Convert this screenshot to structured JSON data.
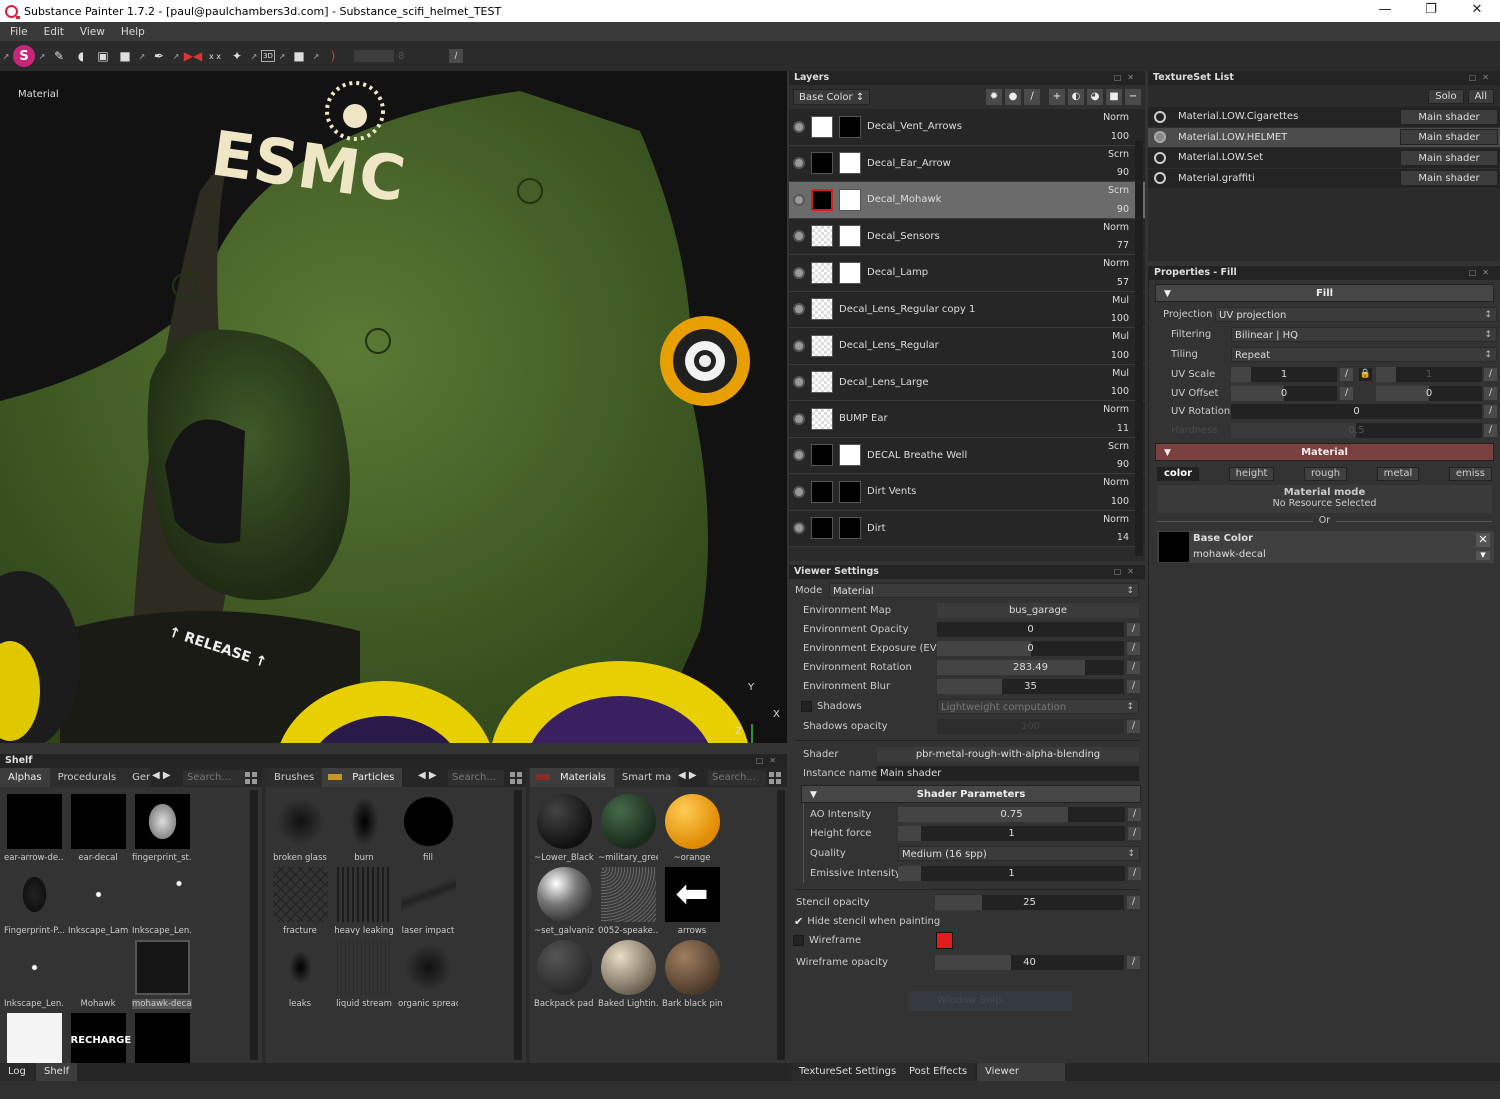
{
  "window": {
    "title": "Substance Painter 1.7.2 - [paul@paulchambers3d.com] - Substance_scifi_helmet_TEST",
    "minimize": "—",
    "restore": "❐",
    "close": "✕"
  },
  "menu": [
    "File",
    "Edit",
    "View",
    "Help"
  ],
  "toolbar": {
    "brush_size_value": "8",
    "tools": [
      "paint-tool",
      "eraser-tool",
      "projection-tool",
      "polygon-fill-tool",
      "color-picker-tool",
      "symmetry-tool",
      "xx-tool",
      "smudge-tool",
      "3d-view-tool",
      "camera-tool",
      "lazy-mouse-tool"
    ]
  },
  "viewport": {
    "mode_label": "Material",
    "decal_text": "ESMC",
    "release_text": "↑ RELEASE ↑",
    "axis": {
      "x": "X",
      "y": "Y",
      "z": "Z"
    }
  },
  "layers": {
    "title": "Layers",
    "channel": "Base Color",
    "items": [
      {
        "name": "Decal_Vent_Arrows",
        "blend": "Norm",
        "opacity": "100",
        "thumb": "white",
        "mask": "black",
        "selected": false
      },
      {
        "name": "Decal_Ear_Arrow",
        "blend": "Scrn",
        "opacity": "90",
        "thumb": "black",
        "mask": "white",
        "selected": false
      },
      {
        "name": "Decal_Mohawk",
        "blend": "Scrn",
        "opacity": "90",
        "thumb": "black",
        "mask": "white",
        "selected": true
      },
      {
        "name": "Decal_Sensors",
        "blend": "Norm",
        "opacity": "77",
        "thumb": "checker",
        "mask": "white",
        "selected": false
      },
      {
        "name": "Decal_Lamp",
        "blend": "Norm",
        "opacity": "57",
        "thumb": "checker",
        "mask": "white",
        "selected": false
      },
      {
        "name": "Decal_Lens_Regular copy 1",
        "blend": "Mul",
        "opacity": "100",
        "thumb": "checker",
        "mask": null,
        "selected": false
      },
      {
        "name": "Decal_Lens_Regular",
        "blend": "Mul",
        "opacity": "100",
        "thumb": "checker",
        "mask": null,
        "selected": false
      },
      {
        "name": "Decal_Lens_Large",
        "blend": "Mul",
        "opacity": "100",
        "thumb": "checker",
        "mask": null,
        "selected": false
      },
      {
        "name": "BUMP Ear",
        "blend": "Norm",
        "opacity": "11",
        "thumb": "checker",
        "mask": null,
        "selected": false
      },
      {
        "name": "DECAL Breathe Well",
        "blend": "Scrn",
        "opacity": "90",
        "thumb": "black",
        "mask": "white",
        "selected": false
      },
      {
        "name": "Dirt Vents",
        "blend": "Norm",
        "opacity": "100",
        "thumb": "black",
        "mask": "black",
        "selected": false
      },
      {
        "name": "Dirt",
        "blend": "Norm",
        "opacity": "14",
        "thumb": "black",
        "mask": "black",
        "selected": false
      }
    ]
  },
  "textureset": {
    "title": "TextureSet List",
    "solo": "Solo",
    "all": "All",
    "items": [
      {
        "name": "Material.LOW.Cigarettes",
        "shader": "Main shader",
        "selected": false
      },
      {
        "name": "Material.LOW.HELMET",
        "shader": "Main shader",
        "selected": true
      },
      {
        "name": "Material.LOW.Set",
        "shader": "Main shader",
        "selected": false
      },
      {
        "name": "Material.graffiti",
        "shader": "Main shader",
        "selected": false
      }
    ]
  },
  "properties": {
    "title": "Properties - Fill",
    "fill_section": "Fill",
    "projection_label": "Projection",
    "projection_value": "UV projection",
    "filtering_label": "Filtering",
    "filtering_value": "Bilinear | HQ",
    "tiling_label": "Tiling",
    "tiling_value": "Repeat",
    "uv_scale_label": "UV Scale",
    "uv_scale_u": "1",
    "uv_scale_v": "1",
    "uv_offset_label": "UV Offset",
    "uv_offset_u": "0",
    "uv_offset_v": "0",
    "uv_rotation_label": "UV Rotation",
    "uv_rotation_value": "0",
    "hardness_label": "Hardness",
    "hardness_value": "0.5",
    "material_section": "Material",
    "channels": [
      "color",
      "height",
      "rough",
      "metal",
      "emiss"
    ],
    "active_channel": "color",
    "material_mode_title": "Material mode",
    "material_mode_status": "No Resource Selected",
    "or_label": "Or",
    "base_color_label": "Base Color",
    "base_color_resource": "mohawk-decal"
  },
  "viewer": {
    "title": "Viewer Settings",
    "mode_label": "Mode",
    "mode_value": "Material",
    "rows": [
      {
        "label": "Environment Map",
        "value": "bus_garage",
        "type": "button"
      },
      {
        "label": "Environment Opacity",
        "value": "0",
        "type": "slider",
        "fraction": 0.0
      },
      {
        "label": "Environment Exposure (EV)",
        "value": "0",
        "type": "slider",
        "fraction": 0.5
      },
      {
        "label": "Environment Rotation",
        "value": "283.49",
        "type": "slider",
        "fraction": 0.79
      },
      {
        "label": "Environment Blur",
        "value": "35",
        "type": "slider",
        "fraction": 0.35
      }
    ],
    "shadows_label": "Shadows",
    "shadows_value": "Lightweight computation",
    "shadows_checked": false,
    "shadows_opacity_label": "Shadows opacity",
    "shadows_opacity_value": "100",
    "shader_label": "Shader",
    "shader_value": "pbr-metal-rough-with-alpha-blending",
    "instance_label": "Instance name",
    "instance_value": "Main shader",
    "shader_params_title": "Shader Parameters",
    "ao_label": "AO Intensity",
    "ao_value": "0.75",
    "ao_fraction": 0.75,
    "height_force_label": "Height force",
    "height_force_value": "1",
    "height_force_fraction": 0.1,
    "quality_label": "Quality",
    "quality_value": "Medium (16 spp)",
    "emissive_label": "Emissive Intensity",
    "emissive_value": "1",
    "emissive_fraction": 0.1,
    "stencil_opacity_label": "Stencil opacity",
    "stencil_opacity_value": "25",
    "stencil_fraction": 0.25,
    "hide_stencil_label": "Hide stencil when painting",
    "hide_stencil_checked": true,
    "wireframe_label": "Wireframe",
    "wireframe_checked": false,
    "wireframe_color": "#e01c1c",
    "wireframe_opacity_label": "Wireframe opacity",
    "wireframe_opacity_value": "40",
    "wireframe_fraction": 0.4,
    "window_snip": "Window Snip"
  },
  "bottom_tabs_right": [
    "TextureSet Settings",
    "Post Effects",
    "Viewer Settings"
  ],
  "bottom_tabs_right_active": "Viewer Settings",
  "bottom_tabs_left": [
    "Log",
    "Shelf"
  ],
  "bottom_tabs_left_active": "Shelf",
  "shelf": {
    "title": "Shelf",
    "search_placeholder": "Search...",
    "pane1": {
      "tabs": [
        "Alphas",
        "Procedurals",
        "Ger"
      ],
      "active": "Alphas",
      "items": [
        "ear-arrow-de...",
        "ear-decal",
        "fingerprint_st...",
        "Fingerprint-P...",
        "Inkscape_Lamp",
        "Inkscape_Len...",
        "Inkscape_Len...",
        "Mohawk",
        "mohawk-decal",
        "",
        "RECHARGE",
        ""
      ]
    },
    "pane2": {
      "tabs": [
        "Brushes",
        "Particles"
      ],
      "active": "Particles",
      "tab_color": "#c9961e",
      "items": [
        "broken glass",
        "burn",
        "fill",
        "fracture",
        "heavy leaking",
        "laser impact",
        "leaks",
        "liquid stream",
        "organic spread"
      ]
    },
    "pane3": {
      "tabs": [
        "Materials",
        "Smart ma"
      ],
      "active": "Materials",
      "tab_color": "#8a2a2a",
      "items": [
        "~Lower_Black...",
        "~military_green",
        "~orange",
        "~set_galvaniz...",
        "0052-speake...",
        "arrows",
        "Backpack pad...",
        "Baked Lightin...",
        "Bark black pine"
      ]
    }
  }
}
